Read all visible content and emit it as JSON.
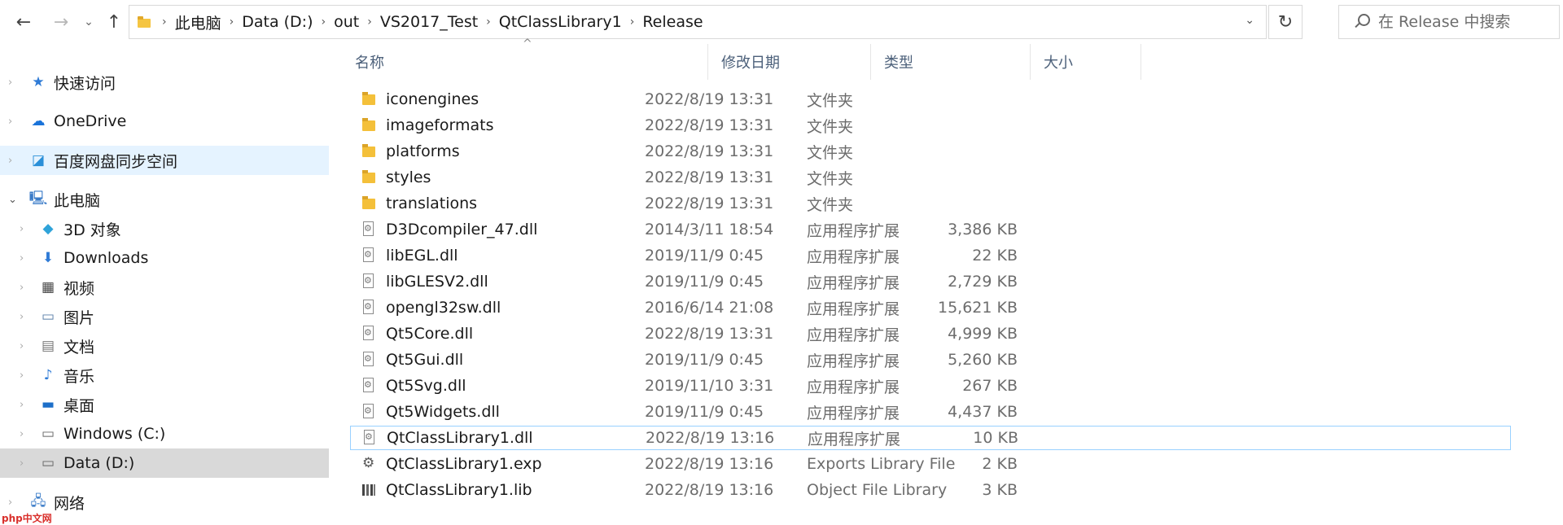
{
  "breadcrumb": [
    "此电脑",
    "Data (D:)",
    "out",
    "VS2017_Test",
    "QtClassLibrary1",
    "Release"
  ],
  "search": {
    "placeholder": "在 Release 中搜索"
  },
  "nav": {
    "quick": "快速访问",
    "onedrive": "OneDrive",
    "baidu": "百度网盘同步空间",
    "pc": "此电脑",
    "objects3d": "3D 对象",
    "downloads": "Downloads",
    "videos": "视频",
    "pictures": "图片",
    "documents": "文档",
    "music": "音乐",
    "desktop": "桌面",
    "drive_c": "Windows (C:)",
    "drive_d": "Data (D:)",
    "network": "网络"
  },
  "columns": {
    "name": "名称",
    "date": "修改日期",
    "type": "类型",
    "size": "大小"
  },
  "files": [
    {
      "name": "iconengines",
      "date": "2022/8/19 13:31",
      "type": "文件夹",
      "size": ""
    },
    {
      "name": "imageformats",
      "date": "2022/8/19 13:31",
      "type": "文件夹",
      "size": ""
    },
    {
      "name": "platforms",
      "date": "2022/8/19 13:31",
      "type": "文件夹",
      "size": ""
    },
    {
      "name": "styles",
      "date": "2022/8/19 13:31",
      "type": "文件夹",
      "size": ""
    },
    {
      "name": "translations",
      "date": "2022/8/19 13:31",
      "type": "文件夹",
      "size": ""
    },
    {
      "name": "D3Dcompiler_47.dll",
      "date": "2014/3/11 18:54",
      "type": "应用程序扩展",
      "size": "3,386 KB"
    },
    {
      "name": "libEGL.dll",
      "date": "2019/11/9 0:45",
      "type": "应用程序扩展",
      "size": "22 KB"
    },
    {
      "name": "libGLESV2.dll",
      "date": "2019/11/9 0:45",
      "type": "应用程序扩展",
      "size": "2,729 KB"
    },
    {
      "name": "opengl32sw.dll",
      "date": "2016/6/14 21:08",
      "type": "应用程序扩展",
      "size": "15,621 KB"
    },
    {
      "name": "Qt5Core.dll",
      "date": "2022/8/19 13:31",
      "type": "应用程序扩展",
      "size": "4,999 KB"
    },
    {
      "name": "Qt5Gui.dll",
      "date": "2019/11/9 0:45",
      "type": "应用程序扩展",
      "size": "5,260 KB"
    },
    {
      "name": "Qt5Svg.dll",
      "date": "2019/11/10 3:31",
      "type": "应用程序扩展",
      "size": "267 KB"
    },
    {
      "name": "Qt5Widgets.dll",
      "date": "2019/11/9 0:45",
      "type": "应用程序扩展",
      "size": "4,437 KB"
    },
    {
      "name": "QtClassLibrary1.dll",
      "date": "2022/8/19 13:16",
      "type": "应用程序扩展",
      "size": "10 KB"
    },
    {
      "name": "QtClassLibrary1.exp",
      "date": "2022/8/19 13:16",
      "type": "Exports Library File",
      "size": "2 KB"
    },
    {
      "name": "QtClassLibrary1.lib",
      "date": "2022/8/19 13:16",
      "type": "Object File Library",
      "size": "3 KB"
    }
  ],
  "watermark": "php中文网"
}
